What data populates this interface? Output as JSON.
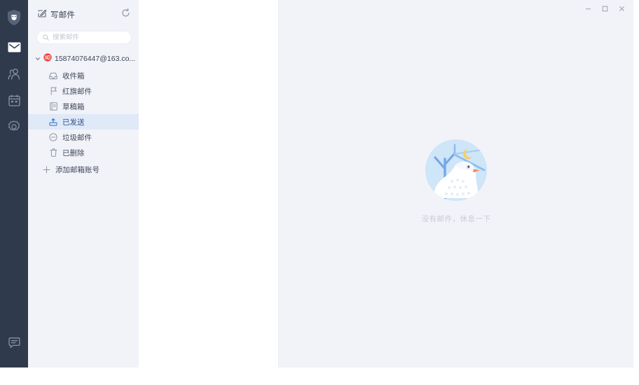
{
  "window": {
    "controls": [
      {
        "name": "minimize",
        "glyph": "minimize-icon"
      },
      {
        "name": "maximize",
        "glyph": "maximize-icon"
      },
      {
        "name": "close",
        "glyph": "close-icon"
      }
    ]
  },
  "rail": {
    "items": [
      {
        "name": "app-logo",
        "icon": "shield-logo-icon",
        "active": false
      },
      {
        "name": "mail",
        "icon": "mail-icon",
        "active": true
      },
      {
        "name": "contacts",
        "icon": "contacts-icon",
        "active": false
      },
      {
        "name": "calendar",
        "icon": "calendar-icon",
        "active": false
      },
      {
        "name": "settings",
        "icon": "gear-icon",
        "active": false
      }
    ],
    "bottom": {
      "name": "feedback",
      "icon": "chat-bubble-icon"
    }
  },
  "sidebar": {
    "compose_label": "写邮件",
    "compose_icon": "compose-icon",
    "refresh_icon": "refresh-icon",
    "search": {
      "placeholder": "搜索邮件",
      "value": "",
      "icon": "search-icon"
    },
    "account": {
      "name": "15874076447@163.co...",
      "full": "15874076447@163.com",
      "provider_badge": "163",
      "expanded": true,
      "chevron": "chevron-down-icon"
    },
    "folders": [
      {
        "label": "收件箱",
        "icon": "inbox-icon",
        "selected": false
      },
      {
        "label": "红旗邮件",
        "icon": "flag-icon",
        "selected": false
      },
      {
        "label": "草稿箱",
        "icon": "draft-icon",
        "selected": false
      },
      {
        "label": "已发送",
        "icon": "sent-icon",
        "selected": true
      },
      {
        "label": "垃圾邮件",
        "icon": "spam-icon",
        "selected": false
      },
      {
        "label": "已删除",
        "icon": "trash-icon",
        "selected": false
      }
    ],
    "add_account": {
      "label": "添加邮箱账号",
      "icon": "plus-icon"
    }
  },
  "content": {
    "empty_text": "没有邮件，休息一下",
    "illustration": "dove-night-branch-illustration"
  },
  "colors": {
    "rail_bg": "#2f3a4d",
    "sidebar_bg": "#f1f3f8",
    "list_bg": "#ffffff",
    "content_bg": "#f2f3f8",
    "selected_row": "#dfe9f8",
    "accent_blue": "#4a90e2",
    "badge_red": "#e8403a",
    "illustration_sky": "#cfe5f8",
    "illustration_branch": "#6ba3e0",
    "illustration_moon": "#f5d06a",
    "illustration_beak": "#ef8b53",
    "empty_text_color": "#c9ccd6"
  }
}
